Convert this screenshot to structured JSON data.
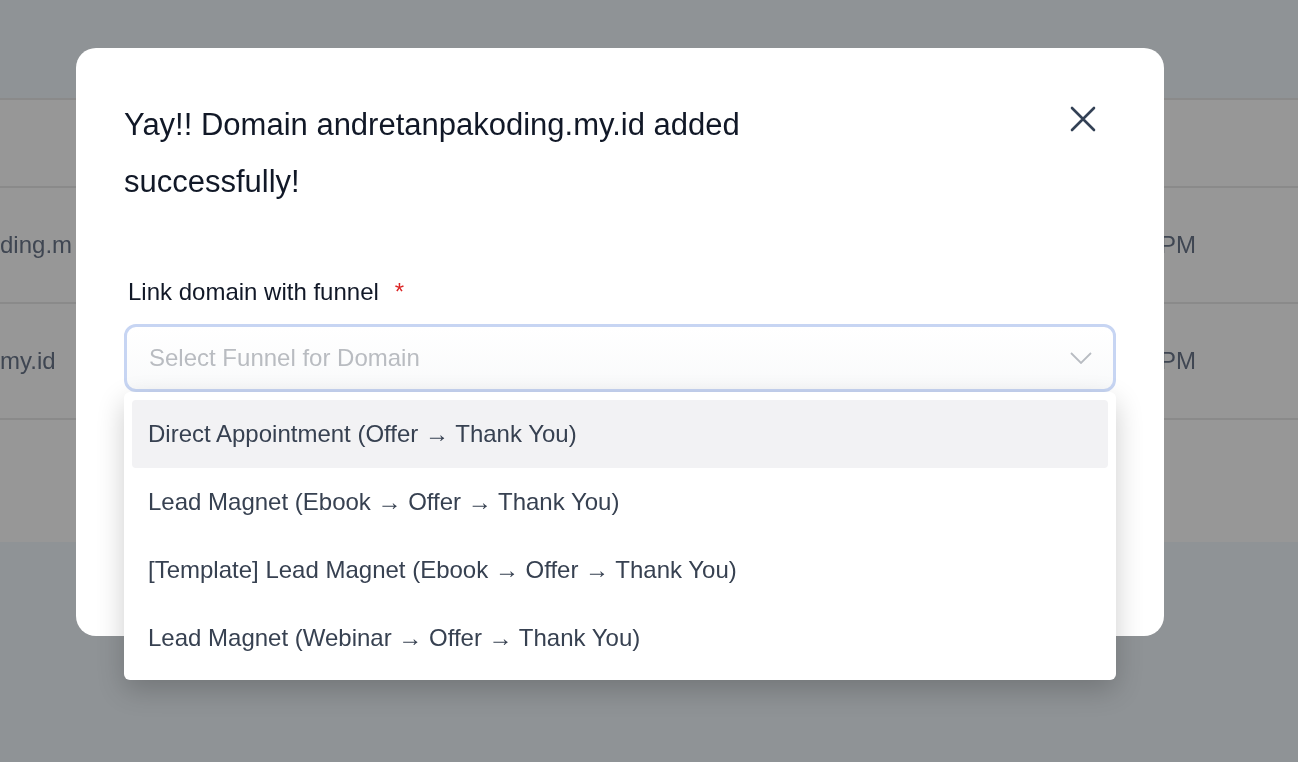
{
  "background_table": {
    "rows": [
      {
        "column_1": "ding.m",
        "column_2": "PM"
      },
      {
        "column_1": "my.id",
        "column_2": "PM"
      }
    ]
  },
  "dialog": {
    "title": "Yay!! Domain andretanpakoding.my.id added successfully!",
    "field": {
      "label": "Link domain with funnel",
      "required_mark": "*",
      "placeholder": "Select Funnel for Domain",
      "expanded": true
    },
    "options": [
      {
        "label": "Direct Appointment (Offer → Thank You)",
        "highlighted": true
      },
      {
        "label": "Lead Magnet (Ebook → Offer → Thank You)",
        "highlighted": false
      },
      {
        "label": "[Template] Lead Magnet (Ebook → Offer → Thank You)",
        "highlighted": false
      },
      {
        "label": "Lead Magnet (Webinar → Offer → Thank You)",
        "highlighted": false
      }
    ]
  }
}
